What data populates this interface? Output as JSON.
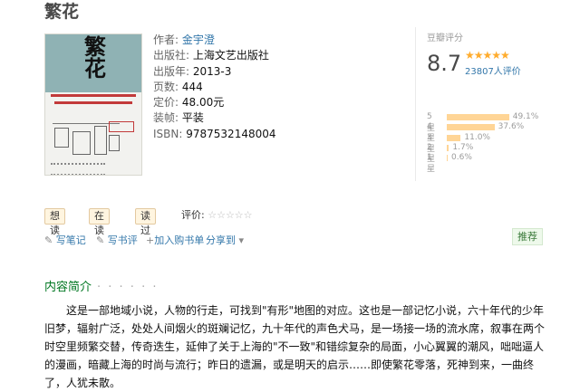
{
  "book": {
    "title": "繁花",
    "cover_title": "繁花",
    "info": [
      {
        "label": "作者:",
        "value": "金宇澄",
        "link": true
      },
      {
        "label": "出版社:",
        "value": "上海文艺出版社",
        "link": false
      },
      {
        "label": "出版年:",
        "value": "2013-3",
        "link": false
      },
      {
        "label": "页数:",
        "value": "444",
        "link": false
      },
      {
        "label": "定价:",
        "value": "48.00元",
        "link": false
      },
      {
        "label": "装帧:",
        "value": "平装",
        "link": false
      },
      {
        "label": "ISBN:",
        "value": "9787532148004",
        "link": false
      }
    ]
  },
  "rating": {
    "label": "豆瓣评分",
    "score": "8.7",
    "stars": "★★★★★",
    "count": "23807人评价",
    "distribution": [
      {
        "label": "5星",
        "percent": "49.1%",
        "value": 49.1
      },
      {
        "label": "4星",
        "percent": "37.6%",
        "value": 37.6
      },
      {
        "label": "3星",
        "percent": "11.0%",
        "value": 11.0
      },
      {
        "label": "2星",
        "percent": "1.7%",
        "value": 1.7
      },
      {
        "label": "1星",
        "percent": "0.6%",
        "value": 0.6
      }
    ]
  },
  "buttons": {
    "want": "想读",
    "reading": "在读",
    "read": "读过"
  },
  "rate_label": "评价:",
  "rate_stars": "☆☆☆☆☆",
  "actions": {
    "note": "写笔记",
    "review": "写书评",
    "cart": "加入购书单",
    "share": "分享到",
    "recommend": "推荐"
  },
  "intro": {
    "title": "内容简介",
    "dots": "· · · · · ·",
    "text": "这是一部地域小说，人物的行走，可找到\"有形\"地图的对应。这也是一部记忆小说，六十年代的少年旧梦，辐射广泛，处处人间烟火的斑斓记忆，九十年代的声色犬马，是一场接一场的流水席，叙事在两个时空里频繁交替，传奇迭生，延伸了关于上海的\"不一致\"和错综复杂的局面，小心翼翼的潮风，咄咄逼人的漫画，暗藏上海的时尚与流行；昨日的遗漏，或是明天的启示……即使繁花零落，死神到来，一曲终了，人犹未散。"
  }
}
